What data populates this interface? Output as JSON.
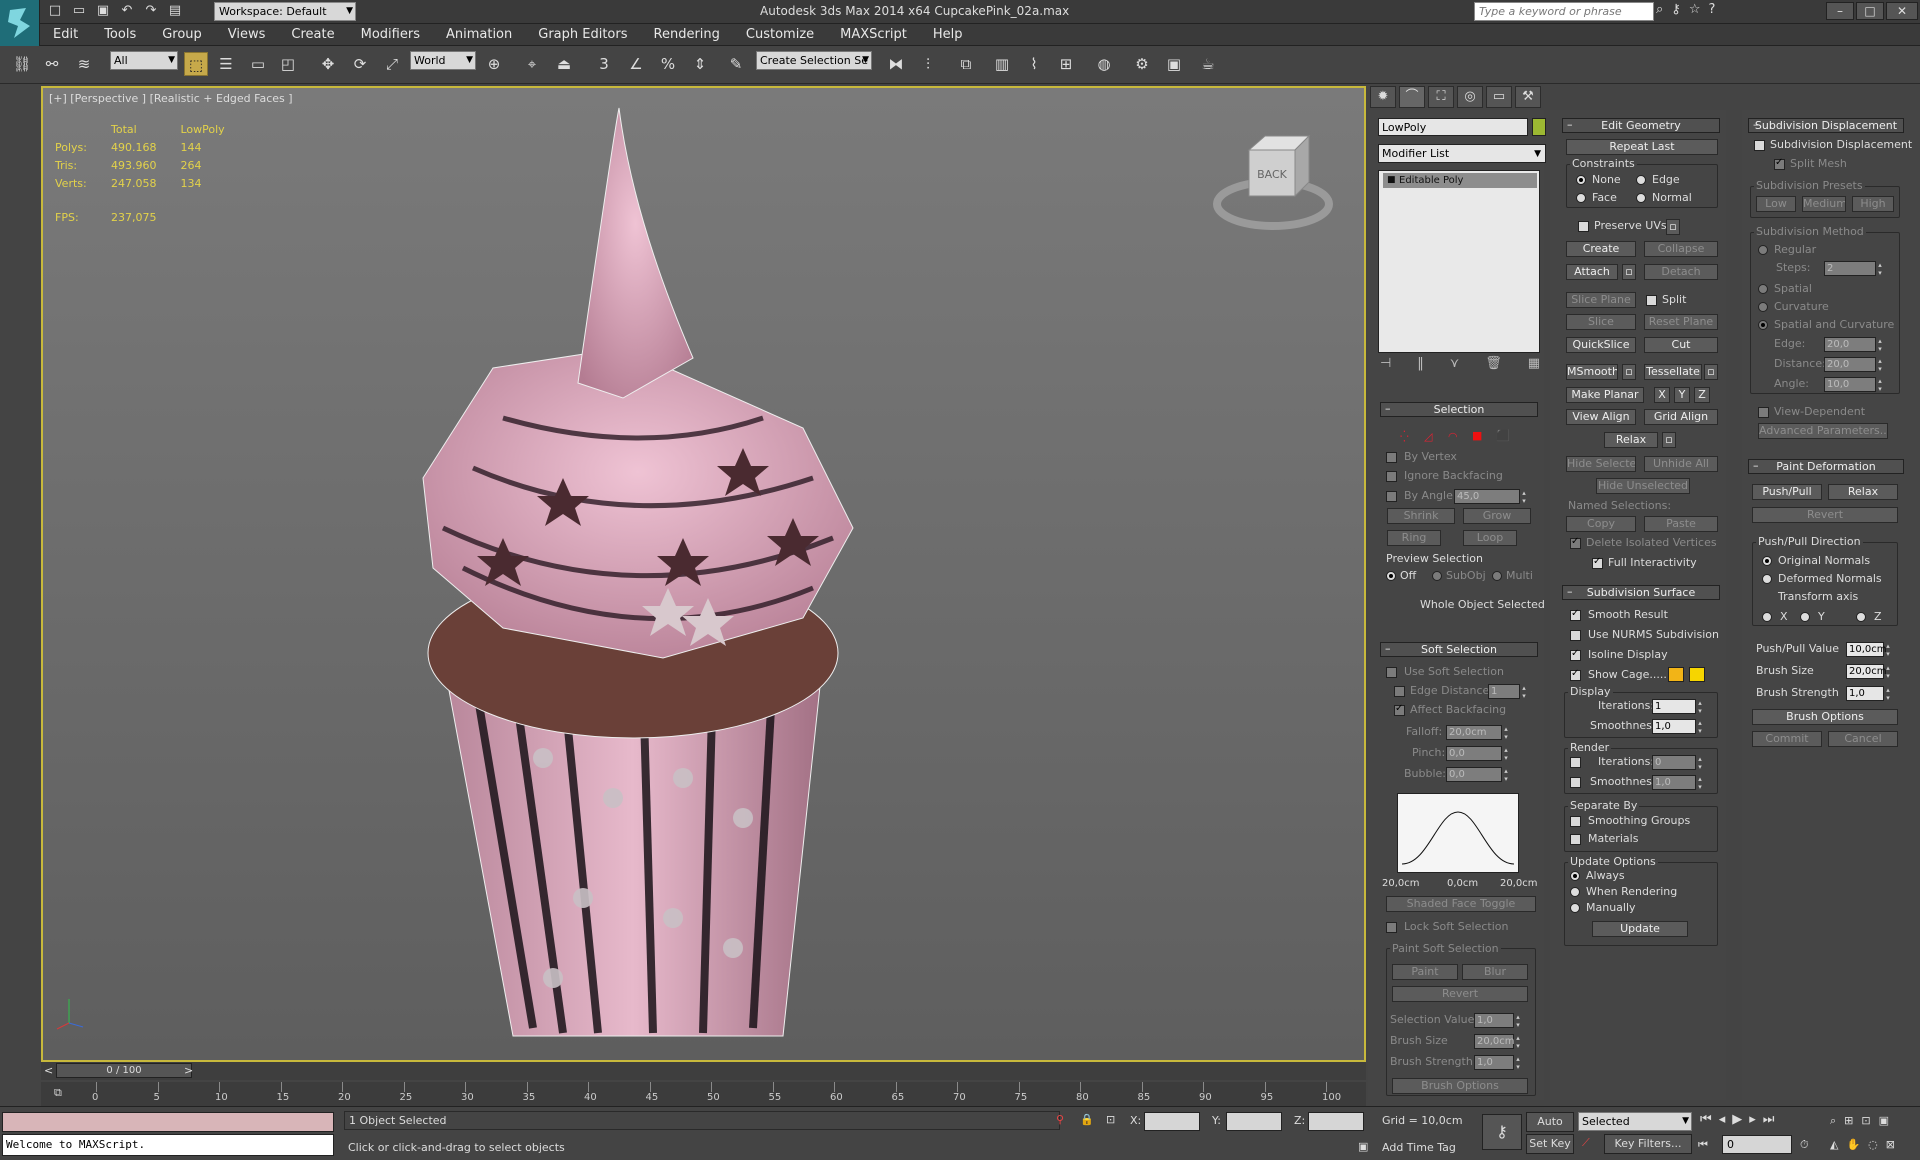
{
  "window": {
    "title": "Autodesk 3ds Max  2014 x64     CupcakePink_02a.max",
    "workspace": "Workspace: Default",
    "search_placeholder": "Type a keyword or phrase"
  },
  "menu": [
    "Edit",
    "Tools",
    "Group",
    "Views",
    "Create",
    "Modifiers",
    "Animation",
    "Graph Editors",
    "Rendering",
    "Customize",
    "MAXScript",
    "Help"
  ],
  "toolbar": {
    "filter": "All",
    "coord": "World",
    "selection_set": "Create Selection Se"
  },
  "viewport": {
    "label": "[+] [Perspective ] [Realistic + Edged Faces ]",
    "stats": {
      "col_total": "Total",
      "col_low": "LowPoly",
      "rows": [
        {
          "k": "Polys:",
          "t": "490.168",
          "l": "144"
        },
        {
          "k": "Tris:",
          "t": "493.960",
          "l": "264"
        },
        {
          "k": "Verts:",
          "t": "247.058",
          "l": "134"
        }
      ],
      "fps_label": "FPS:",
      "fps": "237,075"
    },
    "viewcube": "BACK"
  },
  "command": {
    "object_name": "LowPoly",
    "object_color": "#9cb832",
    "modifier_list": "Modifier List",
    "stack_item": "Editable Poly"
  },
  "selection": {
    "title": "Selection",
    "by_vertex": "By Vertex",
    "ignore_backfacing": "Ignore Backfacing",
    "by_angle": "By Angle:",
    "angle_value": "45,0",
    "shrink": "Shrink",
    "grow": "Grow",
    "ring": "Ring",
    "loop": "Loop",
    "preview": "Preview Selection",
    "off": "Off",
    "subobj": "SubObj",
    "multi": "Multi",
    "status": "Whole Object Selected"
  },
  "soft": {
    "title": "Soft Selection",
    "use": "Use Soft Selection",
    "edge_distance": "Edge Distance:",
    "edge_value": "1",
    "affect_backfacing": "Affect Backfacing",
    "falloff": "Falloff:",
    "falloff_value": "20,0cm",
    "pinch": "Pinch:",
    "pinch_value": "0,0",
    "bubble": "Bubble:",
    "bubble_value": "0,0",
    "curve_left": "20,0cm",
    "curve_mid": "0,0cm",
    "curve_right": "20,0cm",
    "shaded_toggle": "Shaded Face Toggle",
    "lock": "Lock Soft Selection",
    "paint_title": "Paint Soft Selection",
    "paint": "Paint",
    "blur": "Blur",
    "revert": "Revert",
    "sel_value": "Selection Value",
    "sel_value_v": "1,0",
    "brush_size": "Brush Size",
    "brush_size_v": "20,0cm",
    "brush_strength": "Brush Strength",
    "brush_strength_v": "1,0",
    "brush_options": "Brush Options"
  },
  "edit_geometry": {
    "title": "Edit Geometry",
    "repeat_last": "Repeat Last",
    "constraints": "Constraints",
    "none": "None",
    "edge": "Edge",
    "face": "Face",
    "normal": "Normal",
    "preserve_uvs": "Preserve UVs",
    "create": "Create",
    "collapse": "Collapse",
    "attach": "Attach",
    "detach": "Detach",
    "slice_plane": "Slice Plane",
    "split": "Split",
    "slice": "Slice",
    "reset_plane": "Reset Plane",
    "quickslice": "QuickSlice",
    "cut": "Cut",
    "msmooth": "MSmooth",
    "tessellate": "Tessellate",
    "make_planar": "Make Planar",
    "x": "X",
    "y": "Y",
    "z": "Z",
    "view_align": "View Align",
    "grid_align": "Grid Align",
    "relax": "Relax",
    "hide_selected": "Hide Selected",
    "unhide_all": "Unhide All",
    "hide_unselected": "Hide Unselected",
    "named_selections": "Named Selections:",
    "copy": "Copy",
    "paste": "Paste",
    "delete_isolated": "Delete Isolated Vertices",
    "full_interactivity": "Full Interactivity"
  },
  "subdiv_surface": {
    "title": "Subdivision Surface",
    "smooth_result": "Smooth Result",
    "use_nurms": "Use NURMS Subdivision",
    "isoline": "Isoline Display",
    "show_cage": "Show Cage......",
    "cage_color1": "#f2b417",
    "cage_color2": "#f6d500",
    "display": "Display",
    "iterations": "Iterations:",
    "iter_display": "1",
    "smoothness": "Smoothness:",
    "smooth_display": "1,0",
    "render": "Render",
    "iter_render": "0",
    "smooth_render": "1,0",
    "separate_by": "Separate By",
    "smoothing_groups": "Smoothing Groups",
    "materials": "Materials",
    "update_options": "Update Options",
    "always": "Always",
    "when_rendering": "When Rendering",
    "manually": "Manually",
    "update": "Update"
  },
  "subdiv_disp": {
    "title": "Subdivision Displacement",
    "checkbox": "Subdivision Displacement",
    "split_mesh": "Split Mesh",
    "presets": "Subdivision Presets",
    "low": "Low",
    "medium": "Medium",
    "high": "High",
    "method": "Subdivision Method",
    "regular": "Regular",
    "steps": "Steps:",
    "steps_v": "2",
    "spatial": "Spatial",
    "curvature": "Curvature",
    "spatial_curv": "Spatial and Curvature",
    "edge": "Edge:",
    "edge_v": "20,0",
    "distance": "Distance:",
    "distance_v": "20,0",
    "angle": "Angle:",
    "angle_v": "10,0",
    "view_dependent": "View-Dependent",
    "advanced": "Advanced Parameters..."
  },
  "paint_def": {
    "title": "Paint Deformation",
    "push_pull": "Push/Pull",
    "relax": "Relax",
    "revert": "Revert",
    "direction": "Push/Pull Direction",
    "original": "Original Normals",
    "deformed": "Deformed Normals",
    "transform": "Transform axis",
    "x": "X",
    "y": "Y",
    "z": "Z",
    "pp_value": "Push/Pull Value",
    "pp_value_v": "10,0cm",
    "brush_size": "Brush Size",
    "brush_size_v": "20,0cm",
    "brush_strength": "Brush Strength",
    "brush_strength_v": "1,0",
    "brush_options": "Brush Options",
    "commit": "Commit",
    "cancel": "Cancel"
  },
  "timeline": {
    "slider": "0 / 100",
    "ticks": [
      "0",
      "5",
      "10",
      "15",
      "20",
      "25",
      "30",
      "35",
      "40",
      "45",
      "50",
      "55",
      "60",
      "65",
      "70",
      "75",
      "80",
      "85",
      "90",
      "95",
      "100"
    ]
  },
  "status": {
    "maxscript": "Welcome to MAXScript.",
    "selected": "1 Object Selected",
    "prompt": "Click or click-and-drag to select objects",
    "x": "X:",
    "y": "Y:",
    "z": "Z:",
    "grid": "Grid = 10,0cm",
    "add_time_tag": "Add Time Tag",
    "auto_key": "Auto Key",
    "set_key": "Set Key",
    "key_mode": "Selected",
    "key_filters": "Key Filters...",
    "frame": "0"
  }
}
